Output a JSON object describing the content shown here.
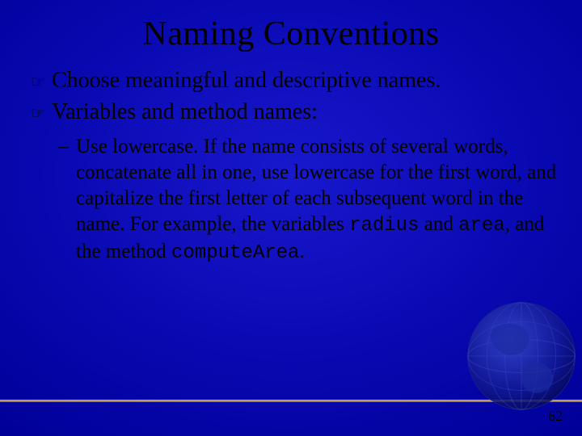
{
  "title": "Naming Conventions",
  "bullets": [
    {
      "icon": "☞",
      "text": "Choose meaningful and descriptive names."
    },
    {
      "icon": "☞",
      "text": "Variables and method names:"
    }
  ],
  "sub": {
    "dash": "–",
    "t1": "Use lowercase. If the name consists of several words, concatenate all in one, use lowercase for the first word, and capitalize the first letter of each subsequent word in the name. For example, the variables ",
    "c1": "radius",
    "t2": " and ",
    "c2": "area",
    "t3": ", and the method ",
    "c3": "computeArea",
    "t4": "."
  },
  "pageNumber": "62"
}
